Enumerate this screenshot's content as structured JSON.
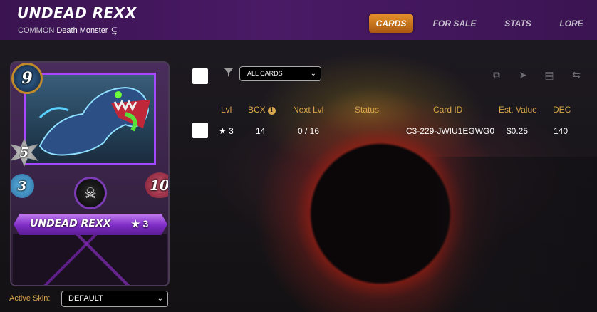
{
  "header": {
    "title": "UNDEAD REXX",
    "rarity": "COMMON",
    "subtitle": "Death Monster",
    "subtitle_icon": "running-figure-icon"
  },
  "nav": {
    "tabs": [
      {
        "label": "CARDS",
        "active": true
      },
      {
        "label": "FOR SALE",
        "active": false
      },
      {
        "label": "STATS",
        "active": false
      },
      {
        "label": "LORE",
        "active": false
      }
    ],
    "active_color": "#e08a28"
  },
  "card": {
    "name": "UNDEAD REXX",
    "level": "★ 3",
    "mana": "9",
    "attack": "5",
    "speed": "3",
    "health": "10",
    "ability_icon": "skull-icon"
  },
  "skin": {
    "label": "Active Skin:",
    "value": "DEFAULT"
  },
  "filter": {
    "value": "ALL CARDS"
  },
  "toolbar": {
    "icons": [
      "combine-icon",
      "send-icon",
      "sell-market-icon",
      "transfer-icon"
    ]
  },
  "table": {
    "columns": [
      "Lvl",
      "BCX",
      "Next Lvl",
      "Status",
      "Card ID",
      "Est. Value",
      "DEC"
    ],
    "rows": [
      {
        "lvl": "★ 3",
        "bcx": "14",
        "next_lvl": "0 / 16",
        "status": "",
        "card_id": "C3-229-JWIU1EGWG0",
        "est_value": "$0.25",
        "dec": "140"
      }
    ]
  }
}
